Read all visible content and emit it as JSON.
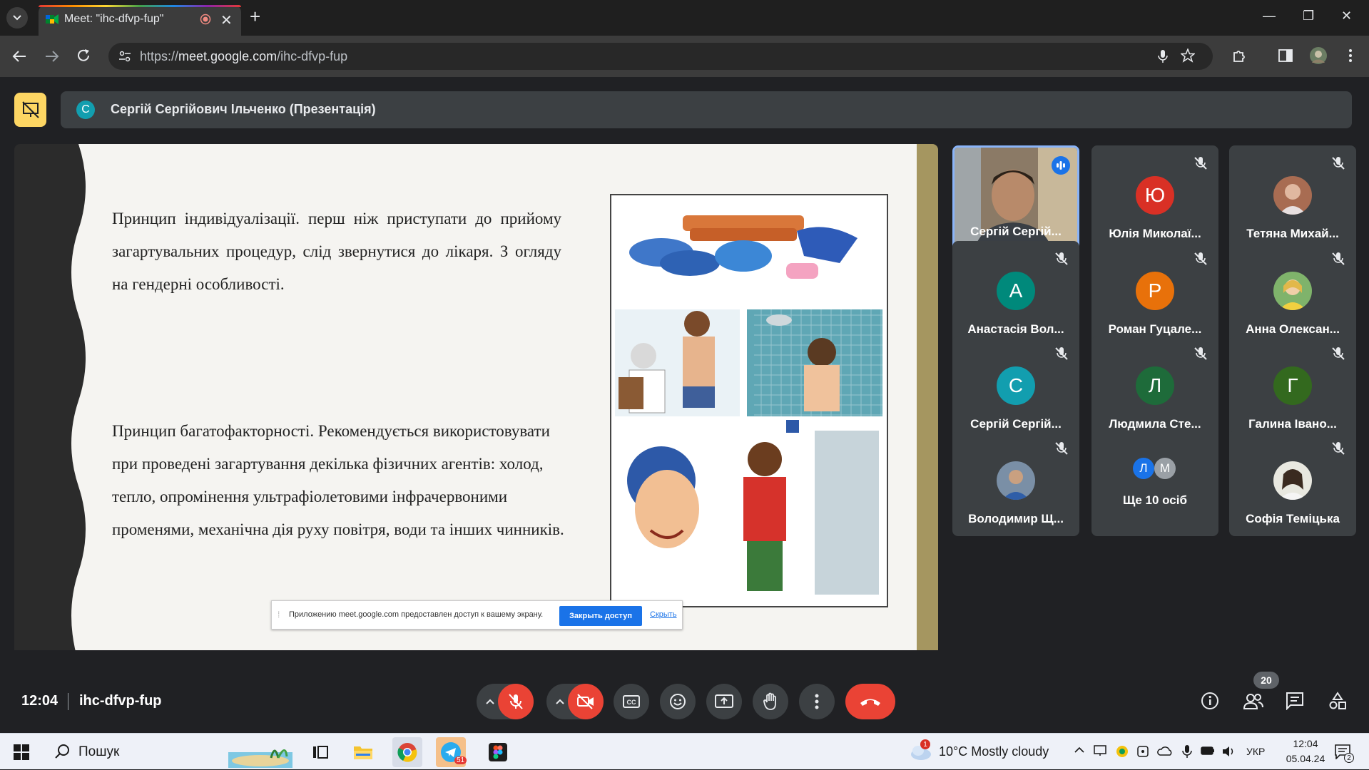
{
  "browser": {
    "tab_title": "Meet: \"ihc-dfvp-fup\"",
    "url_scheme": "https://",
    "url_host": "meet.google.com",
    "url_path": "/ihc-dfvp-fup"
  },
  "meet": {
    "presenter_initial": "С",
    "presenter_label": "Сергій Сергійович Ільченко (Презентація)",
    "slide": {
      "paragraph_1": "Принцип індивідуалізації. перш ніж приступати до прийому загартувальних процедур, слід звернутися до лікаря. З огляду на гендерні особливості.",
      "paragraph_2": "Принцип багатофакторності. Рекомендується використовувати при проведені загартування декілька фізичних агентів: холод, тепло, опромінення ультрафіолетовими інфрачервоними променями, механічна дія руху повітря, води та інших чинників."
    },
    "share_notice": {
      "text": "Приложению meet.google.com предоставлен доступ к вашему экрану.",
      "stop_button": "Закрыть доступ",
      "hide_link": "Скрыть"
    },
    "participants": [
      {
        "name": "Сергій Сергій...",
        "type": "video"
      },
      {
        "name": "Юлія Миколаї...",
        "initial": "Ю",
        "color": "#d93025"
      },
      {
        "name": "Тетяна Михай...",
        "type": "photo"
      },
      {
        "name": "Анастасія Вол...",
        "initial": "А",
        "color": "#00897b"
      },
      {
        "name": "Роман Гуцале...",
        "initial": "Р",
        "color": "#e8710a"
      },
      {
        "name": "Анна Олексан...",
        "type": "photo"
      },
      {
        "name": "Сергій Сергій...",
        "initial": "С",
        "color": "#129eaf"
      },
      {
        "name": "Людмила Сте...",
        "initial": "Л",
        "color": "#1e6b3a"
      },
      {
        "name": "Галина Івано...",
        "initial": "Г",
        "color": "#33691e"
      },
      {
        "name": "Володимир Щ...",
        "type": "photo"
      },
      {
        "name": "Ще 10 осіб",
        "initials": [
          "Л",
          "М"
        ]
      },
      {
        "name": "Софія Теміцька",
        "type": "photo"
      }
    ],
    "clock": "12:04",
    "meeting_code": "ihc-dfvp-fup",
    "people_count": "20"
  },
  "taskbar": {
    "search_label": "Пошук",
    "weather": "10°C  Mostly cloudy",
    "language": "УКР",
    "time": "12:04",
    "date": "05.04.24",
    "telegram_badge": "51",
    "notification_badge": "2",
    "weather_alert": "1"
  }
}
